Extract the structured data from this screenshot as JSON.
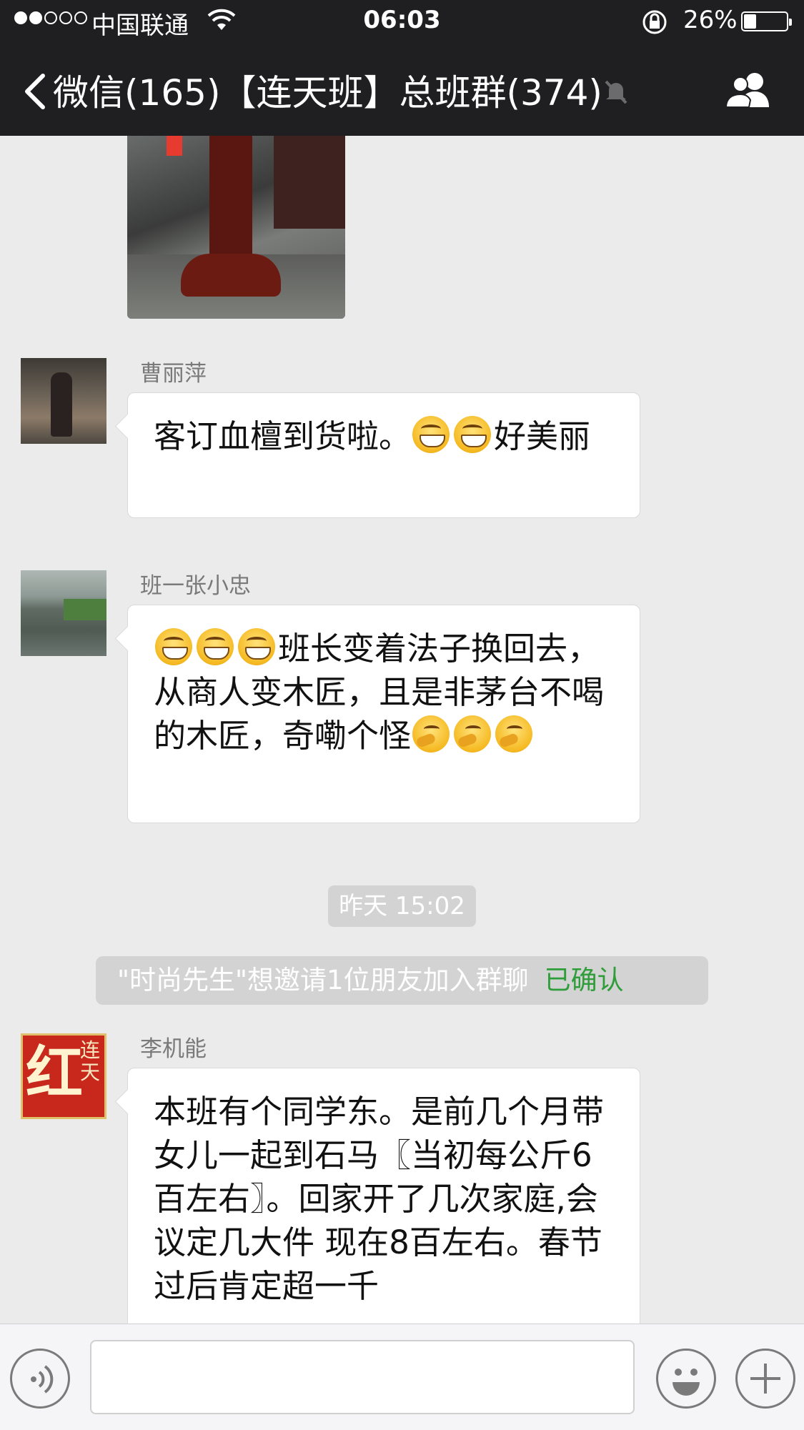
{
  "status_bar": {
    "carrier": "中国联通",
    "time": "06:03",
    "battery_percent": "26%",
    "battery_level": 0.26,
    "signal_filled": 2,
    "signal_total": 5
  },
  "nav": {
    "back_label": "微信(165)",
    "title": "【连天班】总班群(374)",
    "icons": [
      "back-chevron-icon",
      "mute-bell-icon",
      "group-members-icon"
    ]
  },
  "chat": {
    "messages": [
      {
        "sender": "曹丽萍",
        "parts": [
          "客订血檀到货啦。",
          "好美丽"
        ]
      },
      {
        "sender": "班一张小忠",
        "text": "班长变着法子换回去，从商人变木匠，且是非茅台不喝的木匠，奇嘞个怪"
      },
      {
        "sender": "李机能",
        "avatar_text_main": "红",
        "avatar_text_side": "连天",
        "text": "本班有个同学东。是前几个月带女儿一起到石马〖当初每公斤6百左右〗。回家开了几次家庭,会议定几大件 现在8百左右。春节过后肯定超一千"
      }
    ],
    "timestamp": "昨天 15:02",
    "system_notice": "\"时尚先生\"想邀请1位朋友加入群聊",
    "system_notice_action": "已确认"
  },
  "input_bar": {
    "icons": [
      "voice-icon",
      "emoji-face-icon",
      "plus-icon"
    ]
  },
  "colors": {
    "nav_bg": "#1f1f21",
    "chat_bg": "#ebebeb",
    "confirm_green": "#2e9d3a"
  }
}
